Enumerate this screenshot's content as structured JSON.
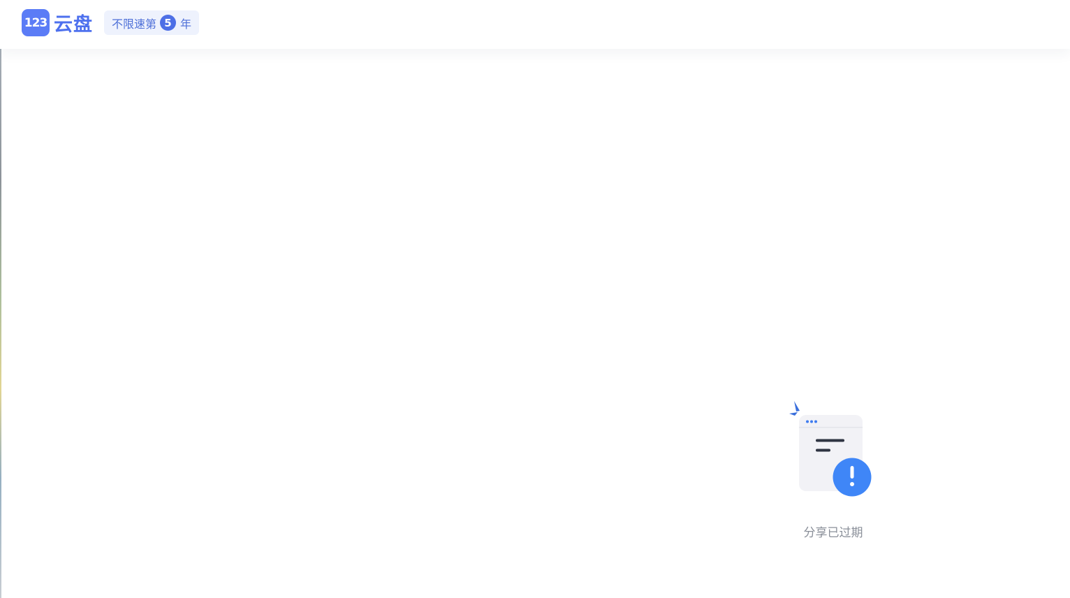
{
  "header": {
    "logo_mark": "123",
    "logo_text": "云盘",
    "slogan": {
      "prefix": "不限速第",
      "number": "5",
      "suffix": "年"
    }
  },
  "main": {
    "empty_icon": "share-expired-icon",
    "status_text": "分享已过期"
  },
  "colors": {
    "brand": "#4d70ee",
    "accent": "#3f86f7",
    "status_text": "#8a8f99"
  }
}
